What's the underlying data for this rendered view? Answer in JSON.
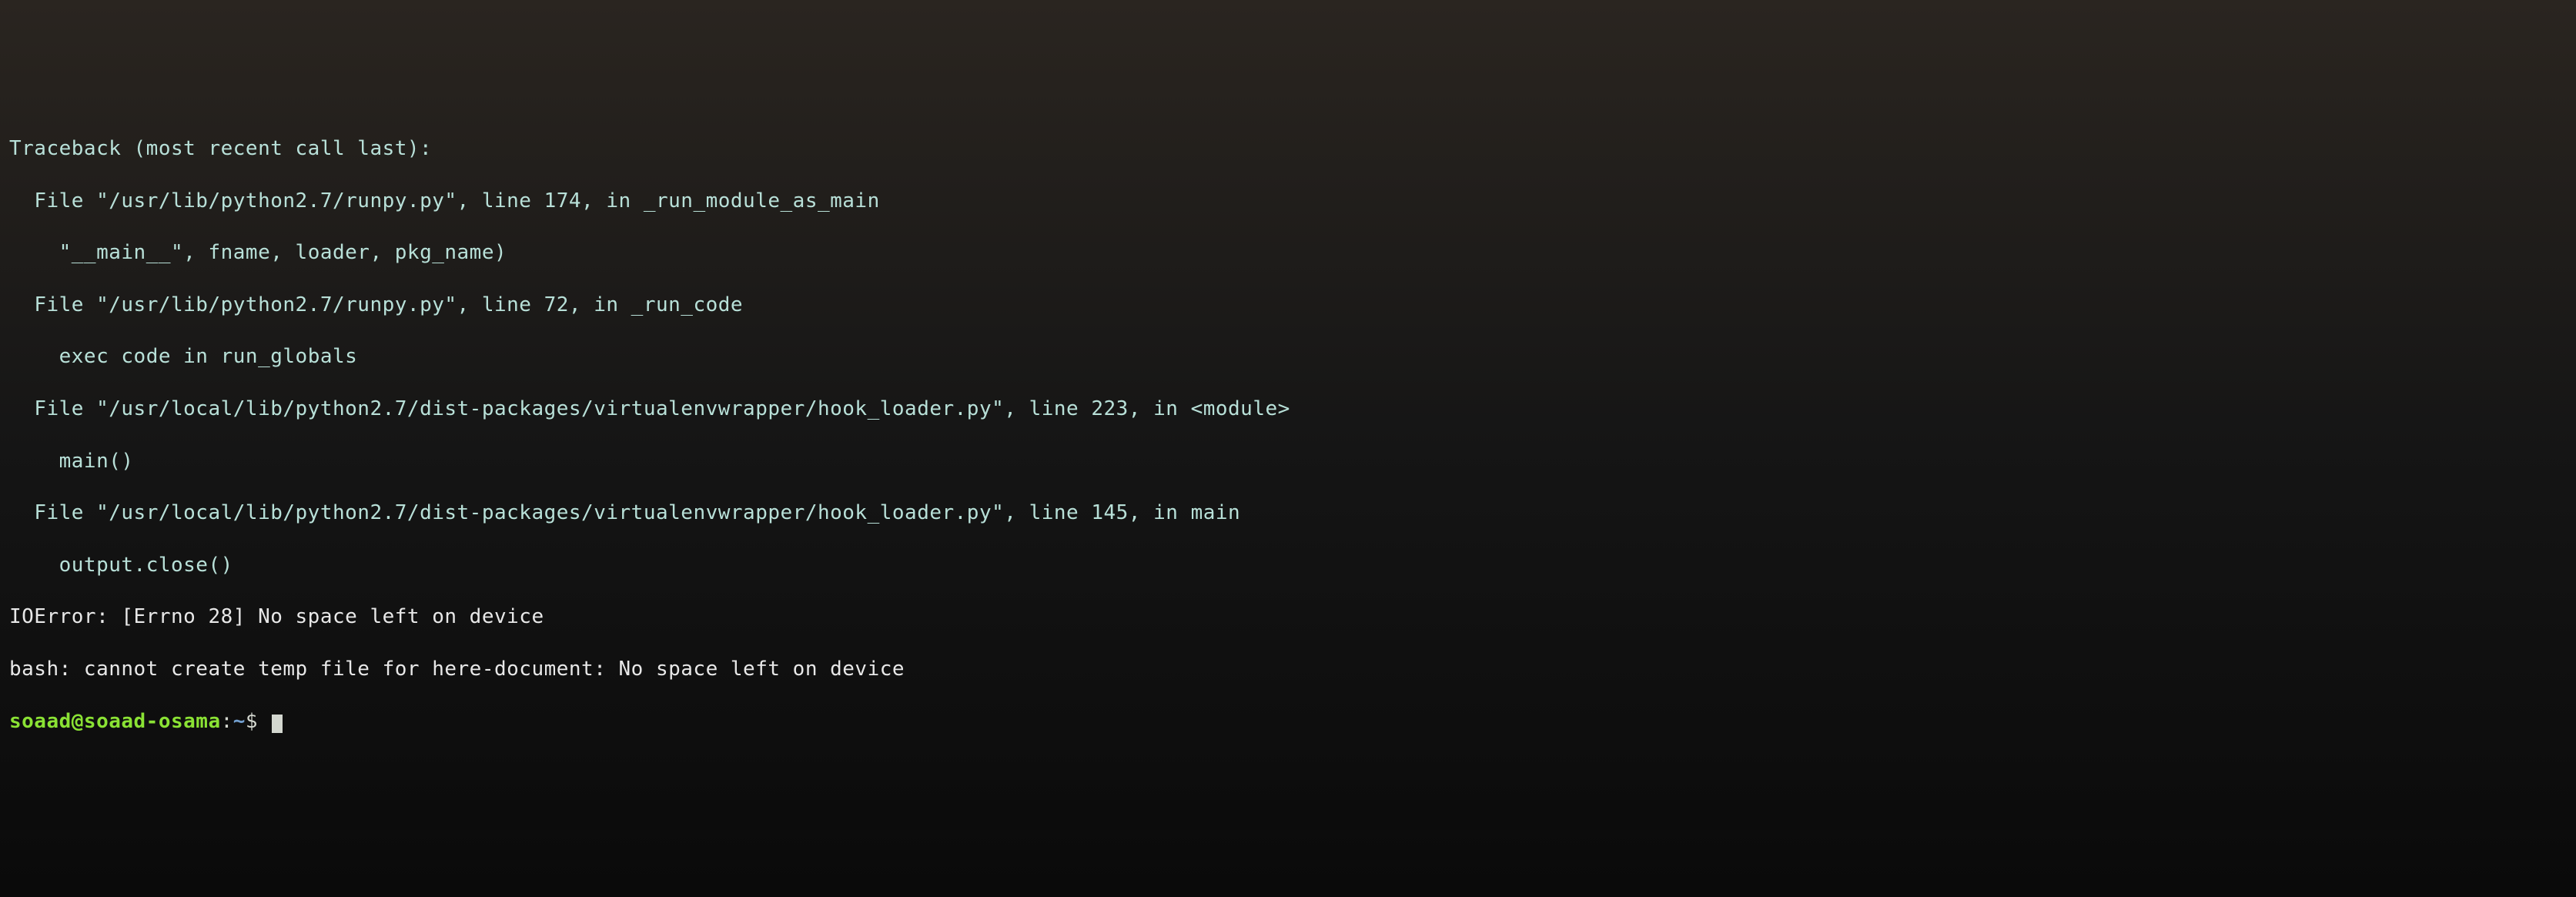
{
  "traceback": {
    "header": "Traceback (most recent call last):",
    "frames": [
      {
        "file_line": "  File \"/usr/lib/python2.7/runpy.py\", line 174, in _run_module_as_main",
        "code_line": "    \"__main__\", fname, loader, pkg_name)"
      },
      {
        "file_line": "  File \"/usr/lib/python2.7/runpy.py\", line 72, in _run_code",
        "code_line": "    exec code in run_globals"
      },
      {
        "file_line": "  File \"/usr/local/lib/python2.7/dist-packages/virtualenvwrapper/hook_loader.py\", line 223, in <module>",
        "code_line": "    main()"
      },
      {
        "file_line": "  File \"/usr/local/lib/python2.7/dist-packages/virtualenvwrapper/hook_loader.py\", line 145, in main",
        "code_line": "    output.close()"
      }
    ],
    "error": "IOError: [Errno 28] No space left on device"
  },
  "bash_error": "bash: cannot create temp file for here-document: No space left on device",
  "prompt": {
    "user_host": "soaad@soaad-osama",
    "separator": ":",
    "path": "~",
    "symbol": "$"
  }
}
